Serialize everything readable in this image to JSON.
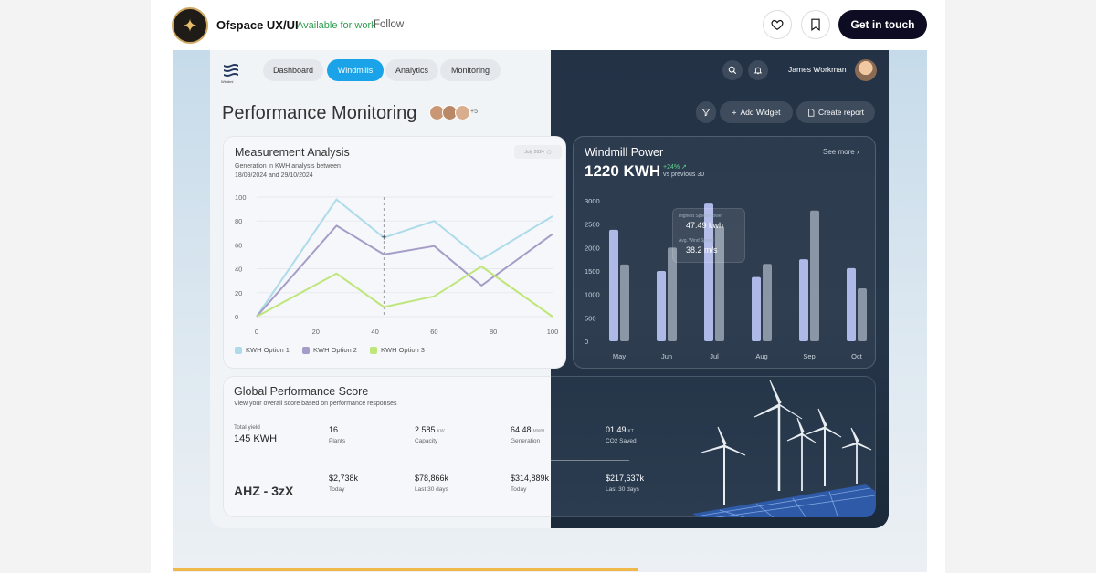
{
  "header": {
    "brand": "Ofspace UX/UI",
    "availability": "Available for work",
    "follow_label": "Follow",
    "cta_label": "Get in touch",
    "like_icon": "heart-icon",
    "save_icon": "bookmark-icon"
  },
  "dashboard": {
    "logo_text": "Windmi",
    "nav": [
      {
        "label": "Dashboard"
      },
      {
        "label": "Windmills"
      },
      {
        "label": "Analytics"
      },
      {
        "label": "Monitoring"
      }
    ],
    "active_nav": "Windmills",
    "user_name": "James Workman",
    "page_title": "Performance Monitoring",
    "team_more": "+5",
    "actions": {
      "add_widget": "Add Widget",
      "create_report": "Create report"
    },
    "colors": {
      "accent": "#1aa3e8",
      "positive": "#5fd48a"
    }
  },
  "measurement": {
    "title": "Measurement Analysis",
    "subtitle_1": "Generation in KWH analysis between",
    "subtitle_2": "18/09/2024 and 29/10/2024",
    "date_chip": "July 2024",
    "legend": [
      {
        "name": "KWH Option 1",
        "color": "#aedbea"
      },
      {
        "name": "KWH Option 2",
        "color": "#a69cc8"
      },
      {
        "name": "KWH Option 3",
        "color": "#bfe67a"
      }
    ]
  },
  "power": {
    "title": "Windmill Power",
    "value": "1220 KWH",
    "change": "+24% ↗",
    "compare": "vs previous 30",
    "see_more": "See more ›",
    "tooltip_label_1": "Highest Speed Power",
    "tooltip_value_1": "47.49 kwh",
    "tooltip_label_2": "Avg. Wind Speed",
    "tooltip_value_2": "38.2 m/s"
  },
  "global": {
    "title": "Global Performance Score",
    "subtitle": "View your overall score based on performance responses",
    "total_yield_label": "Total yield",
    "total_yield_value": "145 KWH",
    "code": "AHZ - 3zX",
    "row1": [
      {
        "value": "16",
        "unit": "",
        "label": "Plants"
      },
      {
        "value": "2.585",
        "unit": "KW",
        "label": "Capacity"
      },
      {
        "value": "64.48",
        "unit": "MWH",
        "label": "Generation"
      },
      {
        "value": "01,49",
        "unit": "KT",
        "label": "CO2 Saved"
      }
    ],
    "row2": [
      {
        "value": "$2,738k",
        "label": "Today"
      },
      {
        "value": "$78,866k",
        "label": "Last 30 days"
      },
      {
        "value": "$314,889k",
        "label": "Today"
      },
      {
        "value": "$217,637k",
        "label": "Last 30 days"
      }
    ]
  },
  "chart_data": [
    {
      "type": "line",
      "title": "Measurement Analysis",
      "x": [
        0,
        27,
        43,
        60,
        76,
        100
      ],
      "xticks": [
        "0",
        "20",
        "40",
        "60",
        "80",
        "100"
      ],
      "yticks": [
        "0",
        "20",
        "40",
        "60",
        "80",
        "100"
      ],
      "xlim": [
        0,
        100
      ],
      "ylim": [
        0,
        100
      ],
      "series": [
        {
          "name": "KWH Option 1",
          "color": "#aedbea",
          "values": [
            0,
            98,
            66,
            80,
            48,
            84
          ]
        },
        {
          "name": "KWH Option 2",
          "color": "#a69cc8",
          "values": [
            0,
            76,
            52,
            59,
            26,
            69
          ]
        },
        {
          "name": "KWH Option 3",
          "color": "#bfe67a",
          "values": [
            0,
            36,
            8,
            17,
            42,
            0
          ]
        }
      ],
      "grid": true
    },
    {
      "type": "bar",
      "title": "Windmill Power",
      "categories": [
        "May",
        "Jun",
        "Jul",
        "Aug",
        "Sep",
        "Oct"
      ],
      "yticks": [
        "0",
        "500",
        "1000",
        "1500",
        "2000",
        "2500",
        "3000"
      ],
      "ylim": [
        0,
        3000
      ],
      "series": [
        {
          "color": "#aeb9e8",
          "values": [
            2380,
            1500,
            2940,
            1370,
            1750,
            1560
          ]
        },
        {
          "color": "#8a96a5",
          "values": [
            1640,
            2000,
            2450,
            1650,
            2790,
            1130
          ]
        }
      ]
    }
  ]
}
